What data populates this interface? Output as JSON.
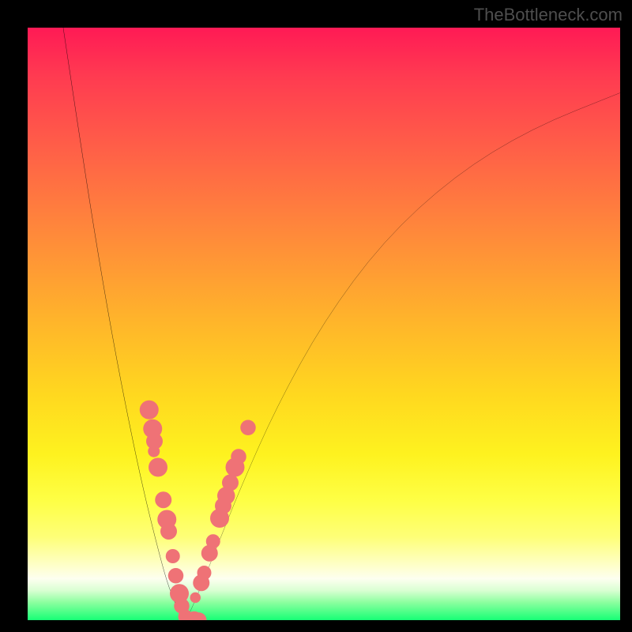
{
  "watermark": "TheBottleneck.com",
  "colors": {
    "frame": "#000000",
    "curve": "#000000",
    "marker_fill": "#ef7276",
    "gradient_stops": [
      "#ff1a55",
      "#ff3a51",
      "#ff5e48",
      "#ff8a3a",
      "#ffb62a",
      "#ffd81f",
      "#fef21f",
      "#feff46",
      "#feff78",
      "#feffbc",
      "#fdfff0",
      "#d9ffd2",
      "#8cff9f",
      "#17ff75"
    ]
  },
  "chart_data": {
    "type": "line",
    "title": "",
    "xlabel": "",
    "ylabel": "",
    "xlim": [
      0,
      1
    ],
    "ylim": [
      0,
      1
    ],
    "series": [
      {
        "name": "left-curve",
        "x": [
          0.06,
          0.09,
          0.12,
          0.15,
          0.18,
          0.2,
          0.22,
          0.235,
          0.25,
          0.26,
          0.268
        ],
        "y": [
          1.0,
          0.8,
          0.61,
          0.44,
          0.29,
          0.2,
          0.12,
          0.065,
          0.025,
          0.008,
          0.0
        ]
      },
      {
        "name": "right-curve",
        "x": [
          0.268,
          0.29,
          0.32,
          0.36,
          0.42,
          0.5,
          0.6,
          0.72,
          0.85,
          1.0
        ],
        "y": [
          0.0,
          0.05,
          0.125,
          0.225,
          0.36,
          0.505,
          0.64,
          0.75,
          0.83,
          0.89
        ]
      }
    ],
    "markers": {
      "name": "scatter-points",
      "points": [
        {
          "x": 0.205,
          "y": 0.355,
          "r": 1.6
        },
        {
          "x": 0.211,
          "y": 0.323,
          "r": 1.6
        },
        {
          "x": 0.214,
          "y": 0.302,
          "r": 1.4
        },
        {
          "x": 0.213,
          "y": 0.285,
          "r": 1.0
        },
        {
          "x": 0.22,
          "y": 0.258,
          "r": 1.6
        },
        {
          "x": 0.229,
          "y": 0.203,
          "r": 1.4
        },
        {
          "x": 0.235,
          "y": 0.17,
          "r": 1.6
        },
        {
          "x": 0.238,
          "y": 0.15,
          "r": 1.4
        },
        {
          "x": 0.245,
          "y": 0.108,
          "r": 1.2
        },
        {
          "x": 0.25,
          "y": 0.075,
          "r": 1.3
        },
        {
          "x": 0.256,
          "y": 0.045,
          "r": 1.6
        },
        {
          "x": 0.26,
          "y": 0.024,
          "r": 1.3
        },
        {
          "x": 0.266,
          "y": 0.006,
          "r": 1.2
        },
        {
          "x": 0.272,
          "y": 0.0,
          "r": 1.3
        },
        {
          "x": 0.281,
          "y": 0.0,
          "r": 1.5
        },
        {
          "x": 0.289,
          "y": 0.0,
          "r": 1.3
        },
        {
          "x": 0.283,
          "y": 0.038,
          "r": 0.9
        },
        {
          "x": 0.293,
          "y": 0.063,
          "r": 1.4
        },
        {
          "x": 0.298,
          "y": 0.08,
          "r": 1.2
        },
        {
          "x": 0.307,
          "y": 0.113,
          "r": 1.4
        },
        {
          "x": 0.313,
          "y": 0.133,
          "r": 1.2
        },
        {
          "x": 0.324,
          "y": 0.172,
          "r": 1.6
        },
        {
          "x": 0.33,
          "y": 0.193,
          "r": 1.4
        },
        {
          "x": 0.335,
          "y": 0.21,
          "r": 1.5
        },
        {
          "x": 0.342,
          "y": 0.232,
          "r": 1.4
        },
        {
          "x": 0.35,
          "y": 0.258,
          "r": 1.6
        },
        {
          "x": 0.356,
          "y": 0.276,
          "r": 1.3
        },
        {
          "x": 0.372,
          "y": 0.325,
          "r": 1.3
        }
      ]
    }
  }
}
